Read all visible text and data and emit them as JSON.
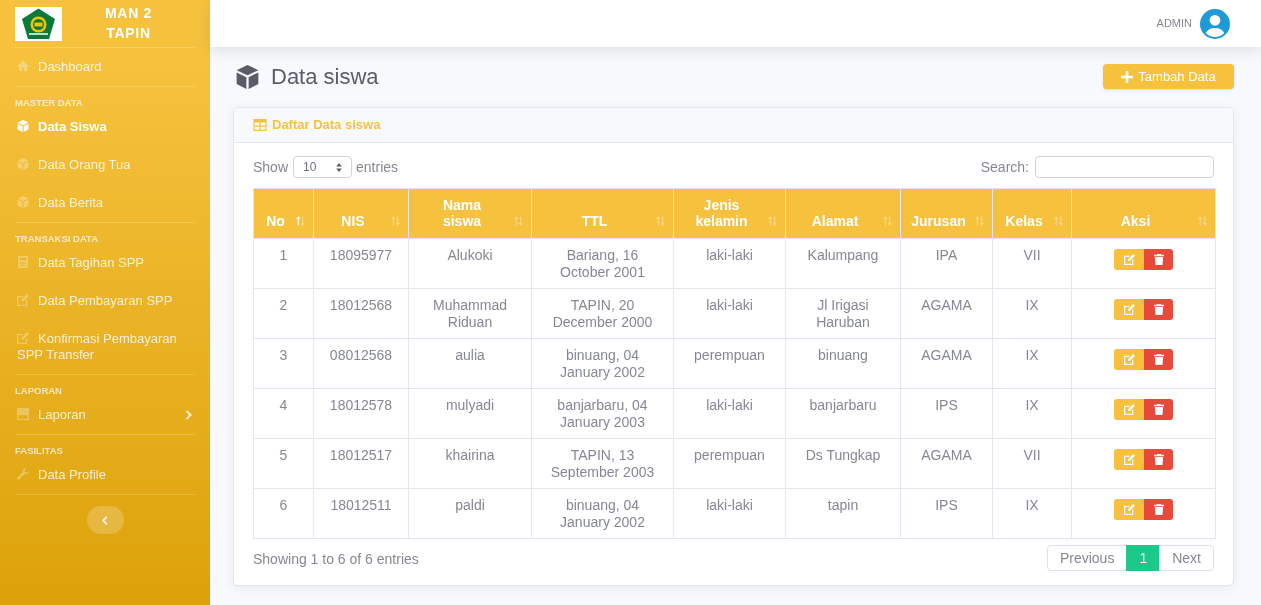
{
  "sidebar": {
    "brand": "MAN 2 TAPIN",
    "sections": [
      {
        "items": [
          {
            "label": "Dashboard",
            "kind": "home",
            "selected": false
          }
        ]
      },
      {
        "heading": "MASTER DATA",
        "items": [
          {
            "label": "Data Siswa",
            "kind": "box",
            "selected": true
          },
          {
            "label": "Data Orang Tua",
            "kind": "box",
            "selected": false
          },
          {
            "label": "Data Berita",
            "kind": "box",
            "selected": false
          }
        ]
      },
      {
        "heading": "TRANSAKSI DATA",
        "items": [
          {
            "label": "Data Tagihan SPP",
            "kind": "calculator",
            "selected": false
          },
          {
            "label": "Data Pembayaran SPP",
            "kind": "edit",
            "selected": false
          },
          {
            "label": "Konfirmasi Pembayaran SPP Transfer",
            "kind": "edit",
            "selected": false
          }
        ]
      },
      {
        "heading": "LAPORAN",
        "items": [
          {
            "label": "Laporan",
            "kind": "drive",
            "selected": false,
            "expanded": false
          }
        ]
      },
      {
        "heading": "FASILITAS",
        "items": [
          {
            "label": "Data Profile",
            "kind": "wrench",
            "selected": false
          }
        ]
      }
    ]
  },
  "topbar": {
    "user": "ADMIN"
  },
  "page": {
    "title": "Data siswa",
    "add_button": "Tambah Data"
  },
  "card": {
    "title": "Daftar Data siswa",
    "length": {
      "before": "Show",
      "value": "10",
      "after": "entries"
    },
    "search": {
      "label": "Search:"
    },
    "table": {
      "columns": [
        {
          "label": "No",
          "kind": "text",
          "sorted": true
        },
        {
          "label": "NIS",
          "kind": "text",
          "sorted": false
        },
        {
          "label": "Nama siswa",
          "kind": "text",
          "sorted": false
        },
        {
          "label": "TTL",
          "kind": "text",
          "sorted": false
        },
        {
          "label": "Jenis kelamin",
          "kind": "text",
          "sorted": false
        },
        {
          "label": "Alamat",
          "kind": "text",
          "sorted": false
        },
        {
          "label": "Jurusan",
          "kind": "text",
          "sorted": false
        },
        {
          "label": "Kelas",
          "kind": "text",
          "sorted": false
        },
        {
          "label": "Aksi",
          "kind": "actions",
          "sorted": false
        }
      ],
      "rows": [
        [
          "1",
          "18095977",
          "Alukoki",
          "Bariang, 16 October 2001",
          "laki-laki",
          "Kalumpang",
          "IPA",
          "VII"
        ],
        [
          "2",
          "18012568",
          "Muhammad Riduan",
          "TAPIN, 20 December 2000",
          "laki-laki",
          "Jl Irigasi Haruban",
          "AGAMA",
          "IX"
        ],
        [
          "3",
          "08012568",
          "aulia",
          "binuang, 04 January 2002",
          "perempuan",
          "binuang",
          "AGAMA",
          "IX"
        ],
        [
          "4",
          "18012578",
          "mulyadi",
          "banjarbaru, 04 January 2003",
          "laki-laki",
          "banjarbaru",
          "IPS",
          "IX"
        ],
        [
          "5",
          "18012517",
          "khairina",
          "TAPIN, 13 September 2003",
          "perempuan",
          "Ds Tungkap",
          "AGAMA",
          "VII"
        ],
        [
          "6",
          "18012511",
          "paldi",
          "binuang, 04 January 2002",
          "laki-laki",
          "tapin",
          "IPS",
          "IX"
        ]
      ]
    },
    "info": "Showing 1 to 6 of 6 entries",
    "pagination": [
      {
        "label": "Previous",
        "selected": false,
        "disabled": true
      },
      {
        "label": "1",
        "selected": true,
        "disabled": false
      },
      {
        "label": "Next",
        "selected": false,
        "disabled": true
      }
    ]
  }
}
